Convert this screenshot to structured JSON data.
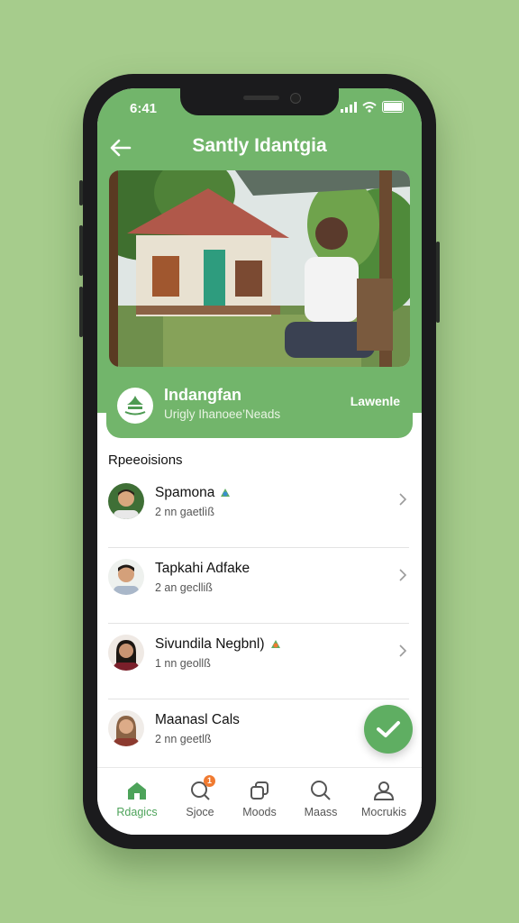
{
  "status": {
    "time": "6:41"
  },
  "header": {
    "title": "Santly Idantgia"
  },
  "profile": {
    "name": "Indangfan",
    "subtitle": "Urigly Ihanoee’Neads",
    "action": "Lawenle"
  },
  "section": {
    "title": "Rpeeoisions"
  },
  "list": [
    {
      "name": "Spamona",
      "sub": "2 nn gaetlìß",
      "has_badge": true
    },
    {
      "name": "Tapkahi Adfake",
      "sub": "2 an geclliß",
      "has_badge": false
    },
    {
      "name": "Sivundila Negbnl)",
      "sub": "1 nn geollß",
      "has_badge": true
    },
    {
      "name": "Maanasl Cals",
      "sub": "2 nn geetlß",
      "has_badge": false
    }
  ],
  "tabs": [
    {
      "label": "Rdagics",
      "icon": "home-icon",
      "active": true
    },
    {
      "label": "Sjoce",
      "icon": "search-icon",
      "active": false,
      "badge": "1"
    },
    {
      "label": "Moods",
      "icon": "squares-icon",
      "active": false
    },
    {
      "label": "Maass",
      "icon": "search-icon",
      "active": false
    },
    {
      "label": "Mocrukis",
      "icon": "profile-icon",
      "active": false
    }
  ],
  "colors": {
    "background": "#a6cc8c",
    "accent": "#72b56b",
    "tab_active": "#4da35a",
    "badge": "#f07a30"
  }
}
